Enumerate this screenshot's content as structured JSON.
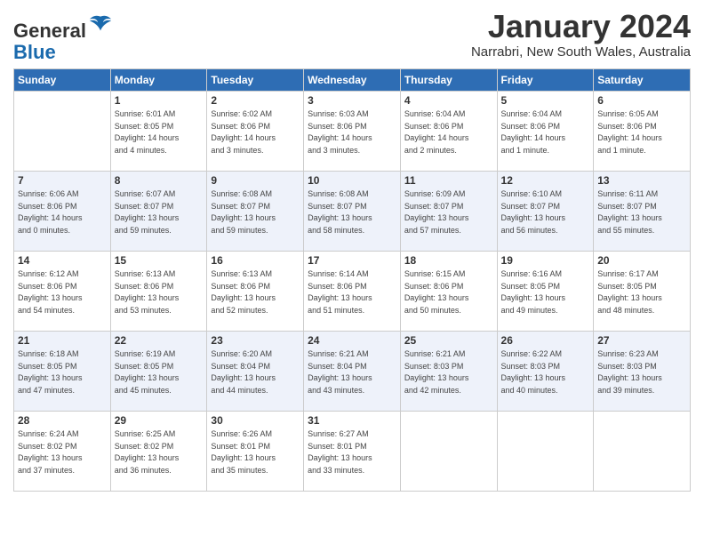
{
  "app": {
    "logo_general": "General",
    "logo_blue": "Blue",
    "title": "January 2024",
    "subtitle": "Narrabri, New South Wales, Australia"
  },
  "calendar": {
    "days_of_week": [
      "Sunday",
      "Monday",
      "Tuesday",
      "Wednesday",
      "Thursday",
      "Friday",
      "Saturday"
    ],
    "weeks": [
      [
        {
          "day": "",
          "info": ""
        },
        {
          "day": "1",
          "info": "Sunrise: 6:01 AM\nSunset: 8:05 PM\nDaylight: 14 hours\nand 4 minutes."
        },
        {
          "day": "2",
          "info": "Sunrise: 6:02 AM\nSunset: 8:06 PM\nDaylight: 14 hours\nand 3 minutes."
        },
        {
          "day": "3",
          "info": "Sunrise: 6:03 AM\nSunset: 8:06 PM\nDaylight: 14 hours\nand 3 minutes."
        },
        {
          "day": "4",
          "info": "Sunrise: 6:04 AM\nSunset: 8:06 PM\nDaylight: 14 hours\nand 2 minutes."
        },
        {
          "day": "5",
          "info": "Sunrise: 6:04 AM\nSunset: 8:06 PM\nDaylight: 14 hours\nand 1 minute."
        },
        {
          "day": "6",
          "info": "Sunrise: 6:05 AM\nSunset: 8:06 PM\nDaylight: 14 hours\nand 1 minute."
        }
      ],
      [
        {
          "day": "7",
          "info": "Sunrise: 6:06 AM\nSunset: 8:06 PM\nDaylight: 14 hours\nand 0 minutes."
        },
        {
          "day": "8",
          "info": "Sunrise: 6:07 AM\nSunset: 8:07 PM\nDaylight: 13 hours\nand 59 minutes."
        },
        {
          "day": "9",
          "info": "Sunrise: 6:08 AM\nSunset: 8:07 PM\nDaylight: 13 hours\nand 59 minutes."
        },
        {
          "day": "10",
          "info": "Sunrise: 6:08 AM\nSunset: 8:07 PM\nDaylight: 13 hours\nand 58 minutes."
        },
        {
          "day": "11",
          "info": "Sunrise: 6:09 AM\nSunset: 8:07 PM\nDaylight: 13 hours\nand 57 minutes."
        },
        {
          "day": "12",
          "info": "Sunrise: 6:10 AM\nSunset: 8:07 PM\nDaylight: 13 hours\nand 56 minutes."
        },
        {
          "day": "13",
          "info": "Sunrise: 6:11 AM\nSunset: 8:07 PM\nDaylight: 13 hours\nand 55 minutes."
        }
      ],
      [
        {
          "day": "14",
          "info": "Sunrise: 6:12 AM\nSunset: 8:06 PM\nDaylight: 13 hours\nand 54 minutes."
        },
        {
          "day": "15",
          "info": "Sunrise: 6:13 AM\nSunset: 8:06 PM\nDaylight: 13 hours\nand 53 minutes."
        },
        {
          "day": "16",
          "info": "Sunrise: 6:13 AM\nSunset: 8:06 PM\nDaylight: 13 hours\nand 52 minutes."
        },
        {
          "day": "17",
          "info": "Sunrise: 6:14 AM\nSunset: 8:06 PM\nDaylight: 13 hours\nand 51 minutes."
        },
        {
          "day": "18",
          "info": "Sunrise: 6:15 AM\nSunset: 8:06 PM\nDaylight: 13 hours\nand 50 minutes."
        },
        {
          "day": "19",
          "info": "Sunrise: 6:16 AM\nSunset: 8:05 PM\nDaylight: 13 hours\nand 49 minutes."
        },
        {
          "day": "20",
          "info": "Sunrise: 6:17 AM\nSunset: 8:05 PM\nDaylight: 13 hours\nand 48 minutes."
        }
      ],
      [
        {
          "day": "21",
          "info": "Sunrise: 6:18 AM\nSunset: 8:05 PM\nDaylight: 13 hours\nand 47 minutes."
        },
        {
          "day": "22",
          "info": "Sunrise: 6:19 AM\nSunset: 8:05 PM\nDaylight: 13 hours\nand 45 minutes."
        },
        {
          "day": "23",
          "info": "Sunrise: 6:20 AM\nSunset: 8:04 PM\nDaylight: 13 hours\nand 44 minutes."
        },
        {
          "day": "24",
          "info": "Sunrise: 6:21 AM\nSunset: 8:04 PM\nDaylight: 13 hours\nand 43 minutes."
        },
        {
          "day": "25",
          "info": "Sunrise: 6:21 AM\nSunset: 8:03 PM\nDaylight: 13 hours\nand 42 minutes."
        },
        {
          "day": "26",
          "info": "Sunrise: 6:22 AM\nSunset: 8:03 PM\nDaylight: 13 hours\nand 40 minutes."
        },
        {
          "day": "27",
          "info": "Sunrise: 6:23 AM\nSunset: 8:03 PM\nDaylight: 13 hours\nand 39 minutes."
        }
      ],
      [
        {
          "day": "28",
          "info": "Sunrise: 6:24 AM\nSunset: 8:02 PM\nDaylight: 13 hours\nand 37 minutes."
        },
        {
          "day": "29",
          "info": "Sunrise: 6:25 AM\nSunset: 8:02 PM\nDaylight: 13 hours\nand 36 minutes."
        },
        {
          "day": "30",
          "info": "Sunrise: 6:26 AM\nSunset: 8:01 PM\nDaylight: 13 hours\nand 35 minutes."
        },
        {
          "day": "31",
          "info": "Sunrise: 6:27 AM\nSunset: 8:01 PM\nDaylight: 13 hours\nand 33 minutes."
        },
        {
          "day": "",
          "info": ""
        },
        {
          "day": "",
          "info": ""
        },
        {
          "day": "",
          "info": ""
        }
      ]
    ]
  }
}
